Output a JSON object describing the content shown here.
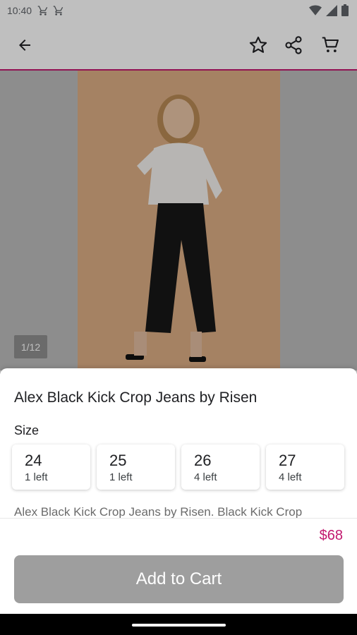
{
  "status_bar": {
    "time": "10:40",
    "left_icons": [
      "cart-icon",
      "cart-icon"
    ],
    "right_icons": [
      "wifi-icon",
      "signal-icon",
      "battery-icon"
    ]
  },
  "toolbar": {
    "icons": [
      "back-arrow-icon",
      "star-icon",
      "share-icon",
      "cart-icon"
    ]
  },
  "gallery": {
    "counter": "1/12"
  },
  "product": {
    "title": "Alex Black Kick Crop Jeans by Risen",
    "size_label": "Size",
    "sizes": [
      {
        "size": "24",
        "stock": "1 left"
      },
      {
        "size": "25",
        "stock": "1 left"
      },
      {
        "size": "26",
        "stock": "4 left"
      },
      {
        "size": "27",
        "stock": "4 left"
      }
    ],
    "description": "Alex Black Kick Crop Jeans by Risen. Black Kick Crop",
    "price": "$68"
  },
  "actions": {
    "add_to_cart": "Add to Cart"
  },
  "colors": {
    "accent": "#c2186f",
    "button": "#9e9e9e"
  }
}
